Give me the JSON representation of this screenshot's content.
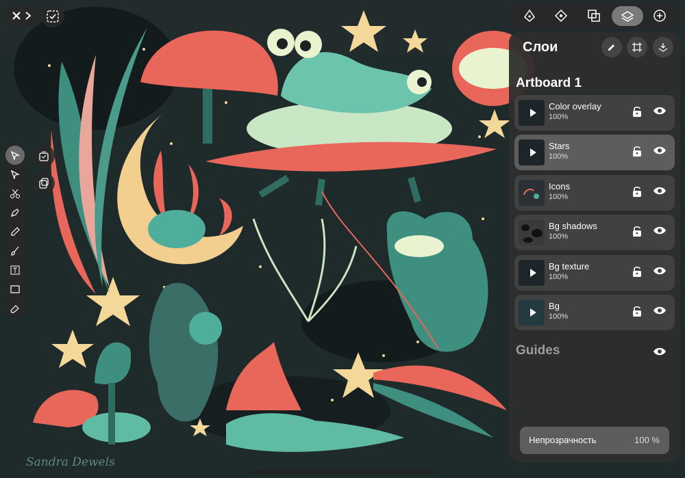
{
  "canvas": {
    "signature": "Sandra Dewels"
  },
  "topbar": {
    "close_icon": "x-icon",
    "expand_icon": "chevron-right-icon",
    "select_icon": "checkbox-select-icon"
  },
  "right_toolbar": [
    "pen-nib-icon",
    "component-icon",
    "boolean-icon",
    "layers-icon",
    "plus-circle-icon"
  ],
  "left_tools": [
    "select-arrow-icon",
    "direct-select-icon",
    "scissors-icon",
    "pen-icon",
    "pencil-icon",
    "brush-icon",
    "text-icon",
    "rectangle-icon",
    "eraser-icon"
  ],
  "left_side_buttons": [
    "duplicate-icon",
    "copy-style-icon"
  ],
  "layers_panel": {
    "title": "Слои",
    "header_buttons": [
      "edit-icon",
      "artboard-icon",
      "import-icon"
    ],
    "artboard_name": "Artboard 1",
    "layers": [
      {
        "name": "Color overlay",
        "opacity": "100%",
        "selected": false
      },
      {
        "name": "Stars",
        "opacity": "100%",
        "selected": true
      },
      {
        "name": "Icons",
        "opacity": "100%",
        "selected": false
      },
      {
        "name": "Bg shadows",
        "opacity": "100%",
        "selected": false
      },
      {
        "name": "Bg texture",
        "opacity": "100%",
        "selected": false
      },
      {
        "name": "Bg",
        "opacity": "100%",
        "selected": false
      }
    ],
    "guides_label": "Guides",
    "opacity_label": "Непрозрачность",
    "opacity_value": "100 %"
  },
  "colors": {
    "accent_coral": "#e8675a",
    "teal": "#3f8f80",
    "star": "#f3d89a",
    "bg": "#1f2a2b"
  }
}
